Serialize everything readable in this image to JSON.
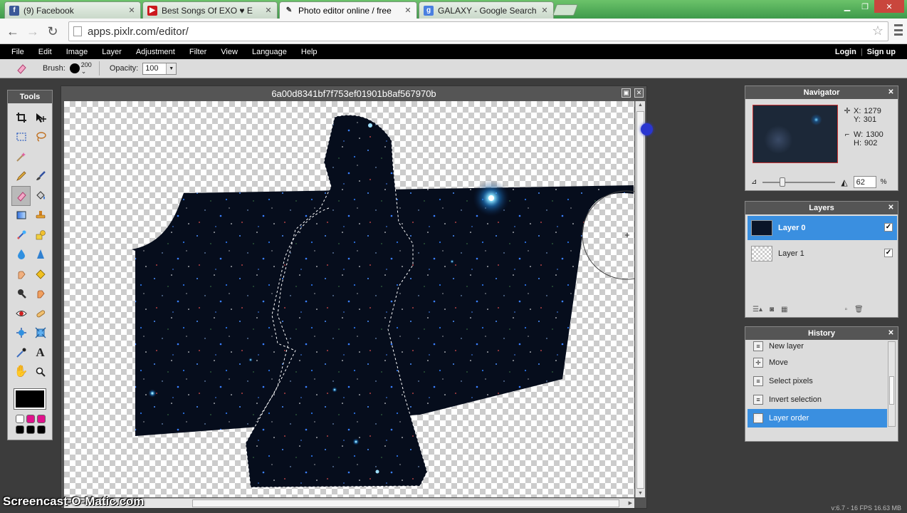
{
  "browser": {
    "tabs": [
      {
        "title": "(9) Facebook",
        "favicon": "facebook-icon",
        "color": "#3b5998",
        "glyph": "f"
      },
      {
        "title": "Best Songs Of EXO ♥ E",
        "favicon": "youtube-icon",
        "color": "#cc181e",
        "glyph": "▶"
      },
      {
        "title": "Photo editor online / free",
        "favicon": "pencil-icon",
        "color": "#ffffff",
        "glyph": "✎"
      },
      {
        "title": "GALAXY - Google Search",
        "favicon": "google-icon",
        "color": "#4a7fe0",
        "glyph": "g"
      }
    ],
    "url": "apps.pixlr.com/editor/"
  },
  "menu": {
    "items": [
      "File",
      "Edit",
      "Image",
      "Layer",
      "Adjustment",
      "Filter",
      "View",
      "Language",
      "Help"
    ],
    "login": "Login",
    "separator": "|",
    "signup": "Sign up"
  },
  "options": {
    "brush_label": "Brush:",
    "brush_size": "200",
    "opacity_label": "Opacity:",
    "opacity_value": "100"
  },
  "tools": {
    "title": "Tools",
    "icons": [
      "crop-icon",
      "move-icon",
      "marquee-icon",
      "lasso-icon",
      "wand-icon",
      "",
      "pencil-icon",
      "brush-icon",
      "eraser-icon",
      "paint-bucket-icon",
      "gradient-icon",
      "clone-stamp-icon",
      "color-replace-icon",
      "drawing-icon",
      "blur-icon",
      "sharpen-icon",
      "smudge-icon",
      "sponge-icon",
      "dodge-icon",
      "burn-icon",
      "red-eye-icon",
      "spot-heal-icon",
      "bloat-icon",
      "pinch-icon",
      "color-picker-icon",
      "type-icon",
      "hand-icon",
      "zoom-icon"
    ],
    "swatches": [
      "#ffffff",
      "#e0128c",
      "#e0128c",
      "#000000",
      "#000000",
      "#000000"
    ]
  },
  "document": {
    "title": "6a00d8341bf7f753ef01901b8af567970b"
  },
  "navigator": {
    "title": "Navigator",
    "x_label": "X:",
    "x": "1279",
    "y_label": "Y:",
    "y": "301",
    "w_label": "W:",
    "w": "1300",
    "h_label": "H:",
    "h": "902",
    "zoom": "62",
    "zoom_unit": "%",
    "zoom_level": 0.25
  },
  "layers": {
    "title": "Layers",
    "items": [
      {
        "name": "Layer 0"
      },
      {
        "name": "Layer 1"
      }
    ]
  },
  "history": {
    "title": "History",
    "items": [
      "New layer",
      "Move",
      "Select pixels",
      "Invert selection",
      "Layer order"
    ]
  },
  "status": {
    "fps": "v:6.7 - 16 FPS 16.63 MB",
    "watermark": "Screencast-O-Matic.com"
  },
  "colors": {
    "accent": "#3a8fe0",
    "foreground": "#000000"
  }
}
